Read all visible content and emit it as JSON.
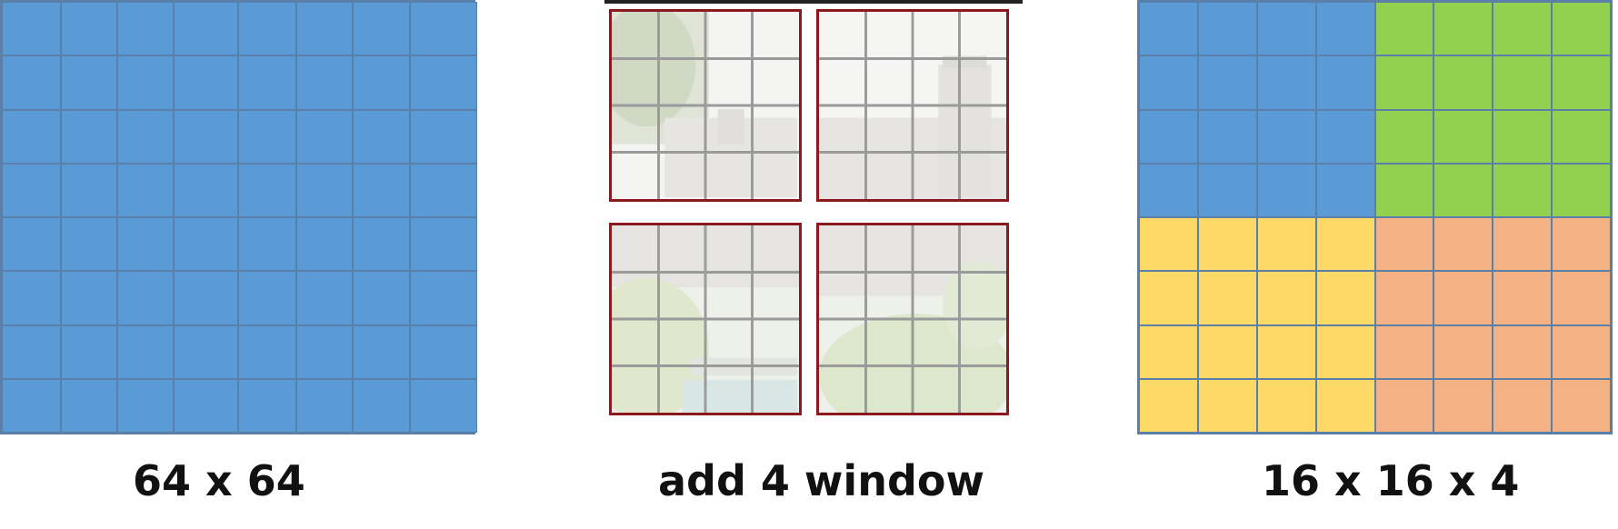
{
  "captions": {
    "left": "64 x 64",
    "middle": "add 4 window",
    "right": "16 x 16 x 4"
  },
  "colors": {
    "blue": "#5b9bd5",
    "green": "#92d050",
    "yellow": "#fdd966",
    "orange": "#f4b183",
    "grid_line": "#5a7fa8",
    "window_frame": "#8b1a1f"
  },
  "left_grid": {
    "rows": 8,
    "cols": 8,
    "fill": "blue"
  },
  "right_grid": {
    "rows": 8,
    "cols": 8,
    "quadrants": {
      "top-left": "blue",
      "top-right": "green",
      "bottom-left": "yellow",
      "bottom-right": "orange"
    }
  },
  "windows": {
    "count": 4,
    "subdivisions": 4
  }
}
